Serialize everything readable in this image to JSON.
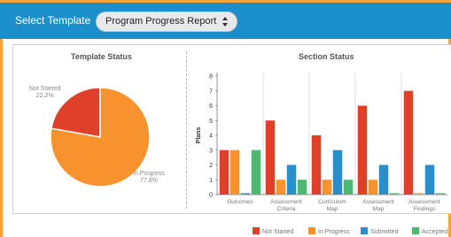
{
  "header": {
    "select_label": "Select Template",
    "template_value": "Program Progress Report"
  },
  "colors": {
    "not_started": "#e0402a",
    "in_progress": "#f7922d",
    "submitted": "#2a8fc9",
    "accepted": "#4cb871"
  },
  "chart_data": [
    {
      "type": "pie",
      "title": "Template Status",
      "slices": [
        {
          "label": "Not Started",
          "percent_label": "22.2%",
          "value": 22.2
        },
        {
          "label": "In Progress",
          "percent_label": "77.8%",
          "value": 77.8
        }
      ]
    },
    {
      "type": "bar",
      "title": "Section Status",
      "ylabel": "Plans",
      "ylim": [
        0,
        8
      ],
      "yticks": [
        "0",
        "1",
        "2",
        "3",
        "4",
        "5",
        "6",
        "7",
        "8"
      ],
      "categories": [
        [
          "Outcomes"
        ],
        [
          "Assessment",
          "Criteria"
        ],
        [
          "Curriculum",
          "Map"
        ],
        [
          "Assessment",
          "Map"
        ],
        [
          "Assessment",
          "Findings"
        ]
      ],
      "series": [
        {
          "name": "Not Started",
          "values": [
            3,
            5,
            4,
            6,
            7
          ]
        },
        {
          "name": "In Progress",
          "values": [
            3,
            1,
            1,
            1,
            0
          ]
        },
        {
          "name": "Submitted",
          "values": [
            0,
            2,
            3,
            2,
            2
          ]
        },
        {
          "name": "Accepted",
          "values": [
            3,
            1,
            1,
            0,
            0
          ]
        }
      ]
    }
  ]
}
